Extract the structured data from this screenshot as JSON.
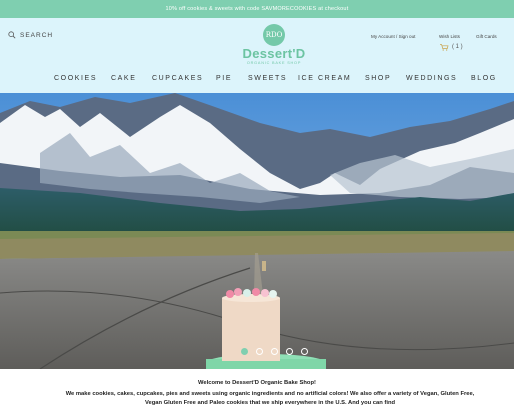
{
  "promo": {
    "text": "10% off cookies & sweets with code SAVMORECOOKIES at checkout"
  },
  "header": {
    "search_label": "SEARCH",
    "search_icon": "search-icon",
    "logo": {
      "emblem": "RDO",
      "name": "Dessert'D",
      "tagline": "ORGANIC BAKE SHOP"
    },
    "account_link": "My Account / Sign out",
    "wishlist_link": "Wish Lists",
    "giftcards_link": "Gift Cards",
    "cart_icon": "cart-icon",
    "cart_count": "( 1 )"
  },
  "nav": {
    "items": [
      "COOKIES",
      "CAKE",
      "CUPCAKES",
      "PIE",
      "SWEETS",
      "ICE CREAM",
      "SHOP",
      "WEDDINGS",
      "BLOG"
    ]
  },
  "hero": {
    "slide_count": 5,
    "active_slide": 1
  },
  "welcome": {
    "title": "Welcome to Dessert'D Organic Bake Shop!",
    "body": "We make cookies, cakes, cupcakes, pies and sweets using organic ingredients and no artificial colors! We also offer a variety of Vegan, Gluten Free, Vegan Gluten Free and Paleo cookies that we ship everywhere in the U.S. And you can find"
  },
  "colors": {
    "brand_mint": "#7fcfb0",
    "header_bg": "#dcf4fb"
  }
}
